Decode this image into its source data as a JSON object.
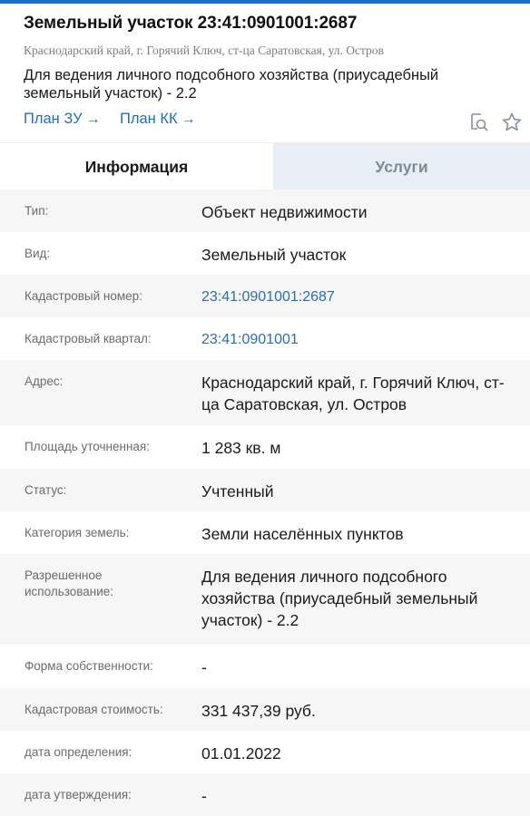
{
  "header": {
    "title": "Земельный участок 23:41:0901001:2687",
    "address": "Краснодарский край, г. Горячий Ключ, ст-ца Саратовская, ул. Остров",
    "purpose": "Для ведения личного подсобного хозяйства (приусадебный земельный участок) - 2.2"
  },
  "links": {
    "plan_zu": "План ЗУ",
    "plan_kk": "План КК",
    "arrow": "→"
  },
  "tabs": {
    "info": "Информация",
    "services": "Услуги"
  },
  "rows": [
    {
      "label": "Тип:",
      "value": "Объект недвижимости"
    },
    {
      "label": "Вид:",
      "value": "Земельный участок"
    },
    {
      "label": "Кадастровый номер:",
      "value": "23:41:0901001:2687"
    },
    {
      "label": "Кадастровый квартал:",
      "value": "23:41:0901001"
    },
    {
      "label": "Адрес:",
      "value": "Краснодарский край, г. Горячий Ключ, ст-ца Саратовская, ул. Остров"
    },
    {
      "label": "Площадь уточненная:",
      "value": "1 283 кв. м"
    },
    {
      "label": "Статус:",
      "value": "Учтенный"
    },
    {
      "label": "Категория земель:",
      "value": "Земли населённых пунктов"
    },
    {
      "label": "Разрешенное использование:",
      "value": "Для ведения личного подсобного хозяйства (приусадебный земельный участок) - 2.2"
    },
    {
      "label": "Форма собственности:",
      "value": "-"
    },
    {
      "label": "Кадастровая стоимость:",
      "value": "331 437,39 руб."
    },
    {
      "label": "дата определения:",
      "value": "01.01.2022"
    },
    {
      "label": "дата утверждения:",
      "value": "-"
    }
  ],
  "icons": {
    "search_map": "search-document-icon",
    "favorite": "star-icon"
  },
  "colors": {
    "accent": "#1e6fc2",
    "link": "#2a6db0",
    "tab_inactive_bg": "#e8eef5",
    "row_shade": "#f6f6f6"
  }
}
